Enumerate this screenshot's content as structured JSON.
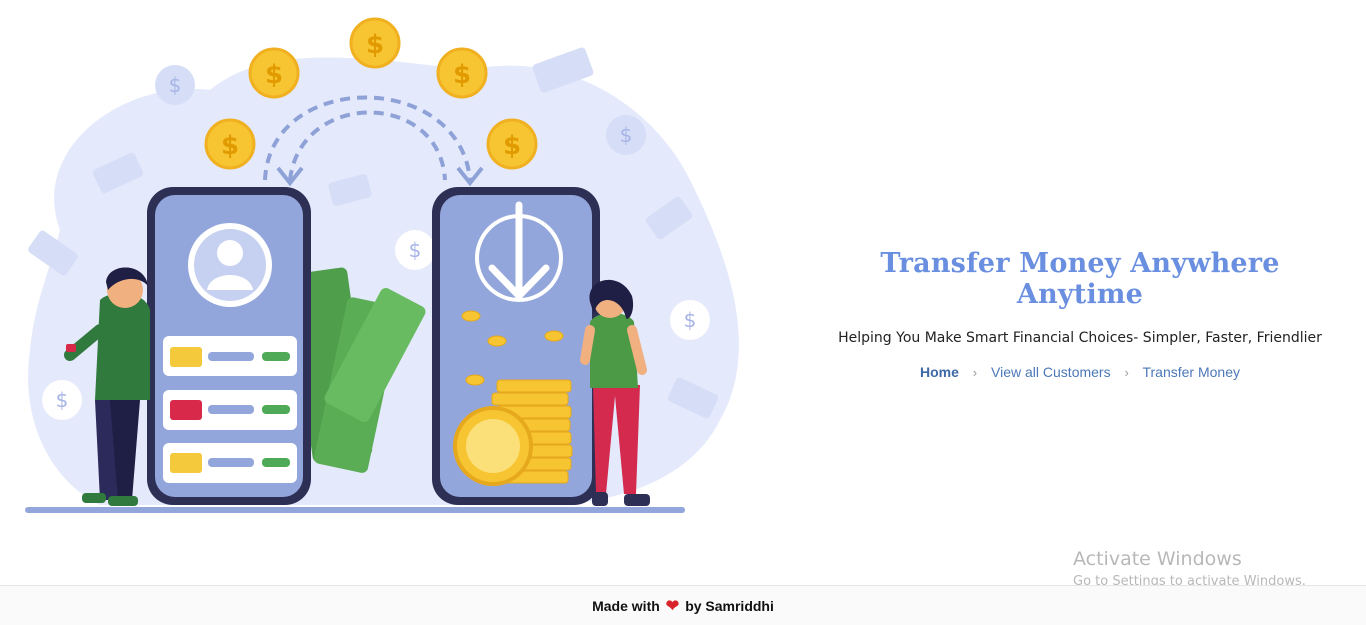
{
  "hero": {
    "title": "Transfer Money Anywhere Anytime",
    "subtitle": "Helping You Make Smart Financial Choices- Simpler, Faster, Friendlier"
  },
  "breadcrumb": [
    {
      "label": "Home"
    },
    {
      "label": "View all Customers"
    },
    {
      "label": "Transfer Money"
    }
  ],
  "illustration": {
    "icon": "money-transfer-illustration",
    "currency_symbol": "$"
  },
  "watermark": {
    "line1": "Activate Windows",
    "line2": "Go to Settings to activate Windows."
  },
  "footer": {
    "made_with": "Made with",
    "by": "by Samriddhi",
    "heart_icon": "heart-icon"
  },
  "colors": {
    "accent": "#6a8fe0",
    "link": "#4b78b8",
    "heart": "#d8232a"
  }
}
